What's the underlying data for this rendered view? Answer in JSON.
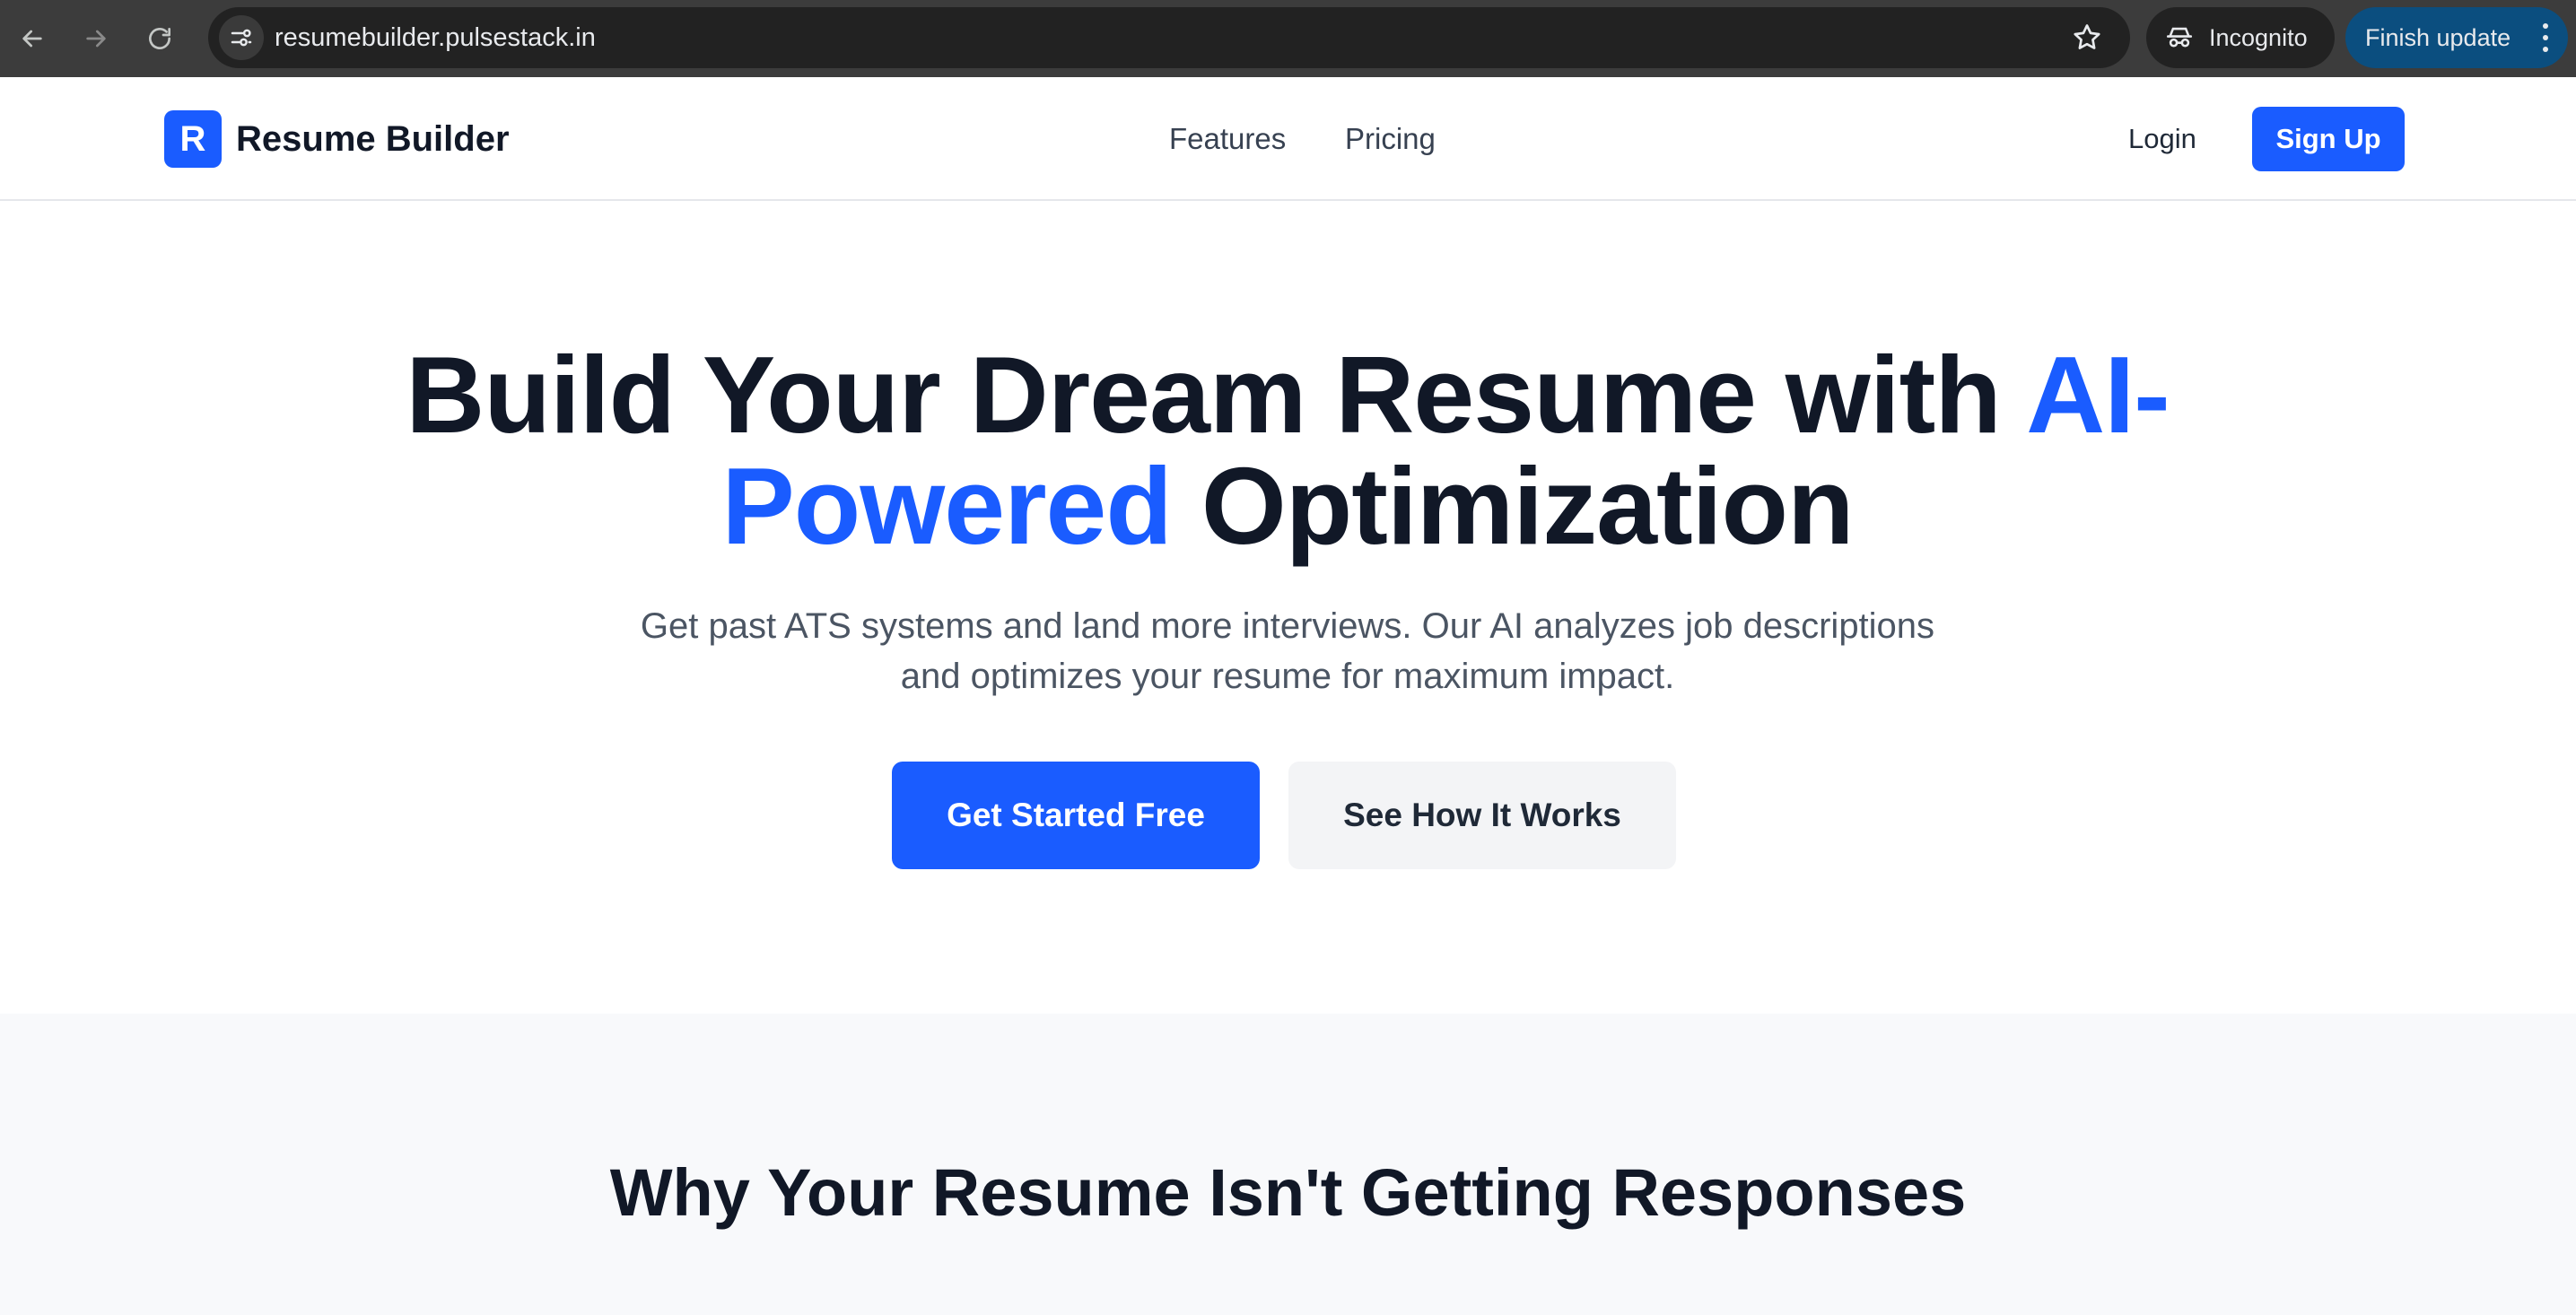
{
  "browser": {
    "url": "resumebuilder.pulsestack.in",
    "incognito_label": "Incognito",
    "update_label": "Finish update",
    "icons": [
      "back-arrow-icon",
      "forward-arrow-icon",
      "reload-icon",
      "site-info-icon",
      "star-icon",
      "incognito-icon",
      "kebab-menu-icon"
    ]
  },
  "header": {
    "logo_letter": "R",
    "logo_text": "Resume Builder",
    "nav": [
      {
        "label": "Features"
      },
      {
        "label": "Pricing"
      }
    ],
    "login_label": "Login",
    "signup_label": "Sign Up"
  },
  "hero": {
    "title_part1": "Build Your Dream Resume with ",
    "title_highlight_a": "AI-",
    "title_highlight_b": "Powered",
    "title_part2": " Optimization",
    "subtitle_line1": "Get past ATS systems and land more interviews. Our AI analyzes job descriptions",
    "subtitle_line2": "and optimizes your resume for maximum impact.",
    "primary_cta": "Get Started Free",
    "secondary_cta": "See How It Works"
  },
  "problem": {
    "title": "Why Your Resume Isn't Getting Responses"
  },
  "colors": {
    "brand": "#1a5cff",
    "heading": "#111827",
    "body": "#4b5563",
    "chrome": "#3c3c3c",
    "update_button": "#0b4e7f"
  }
}
